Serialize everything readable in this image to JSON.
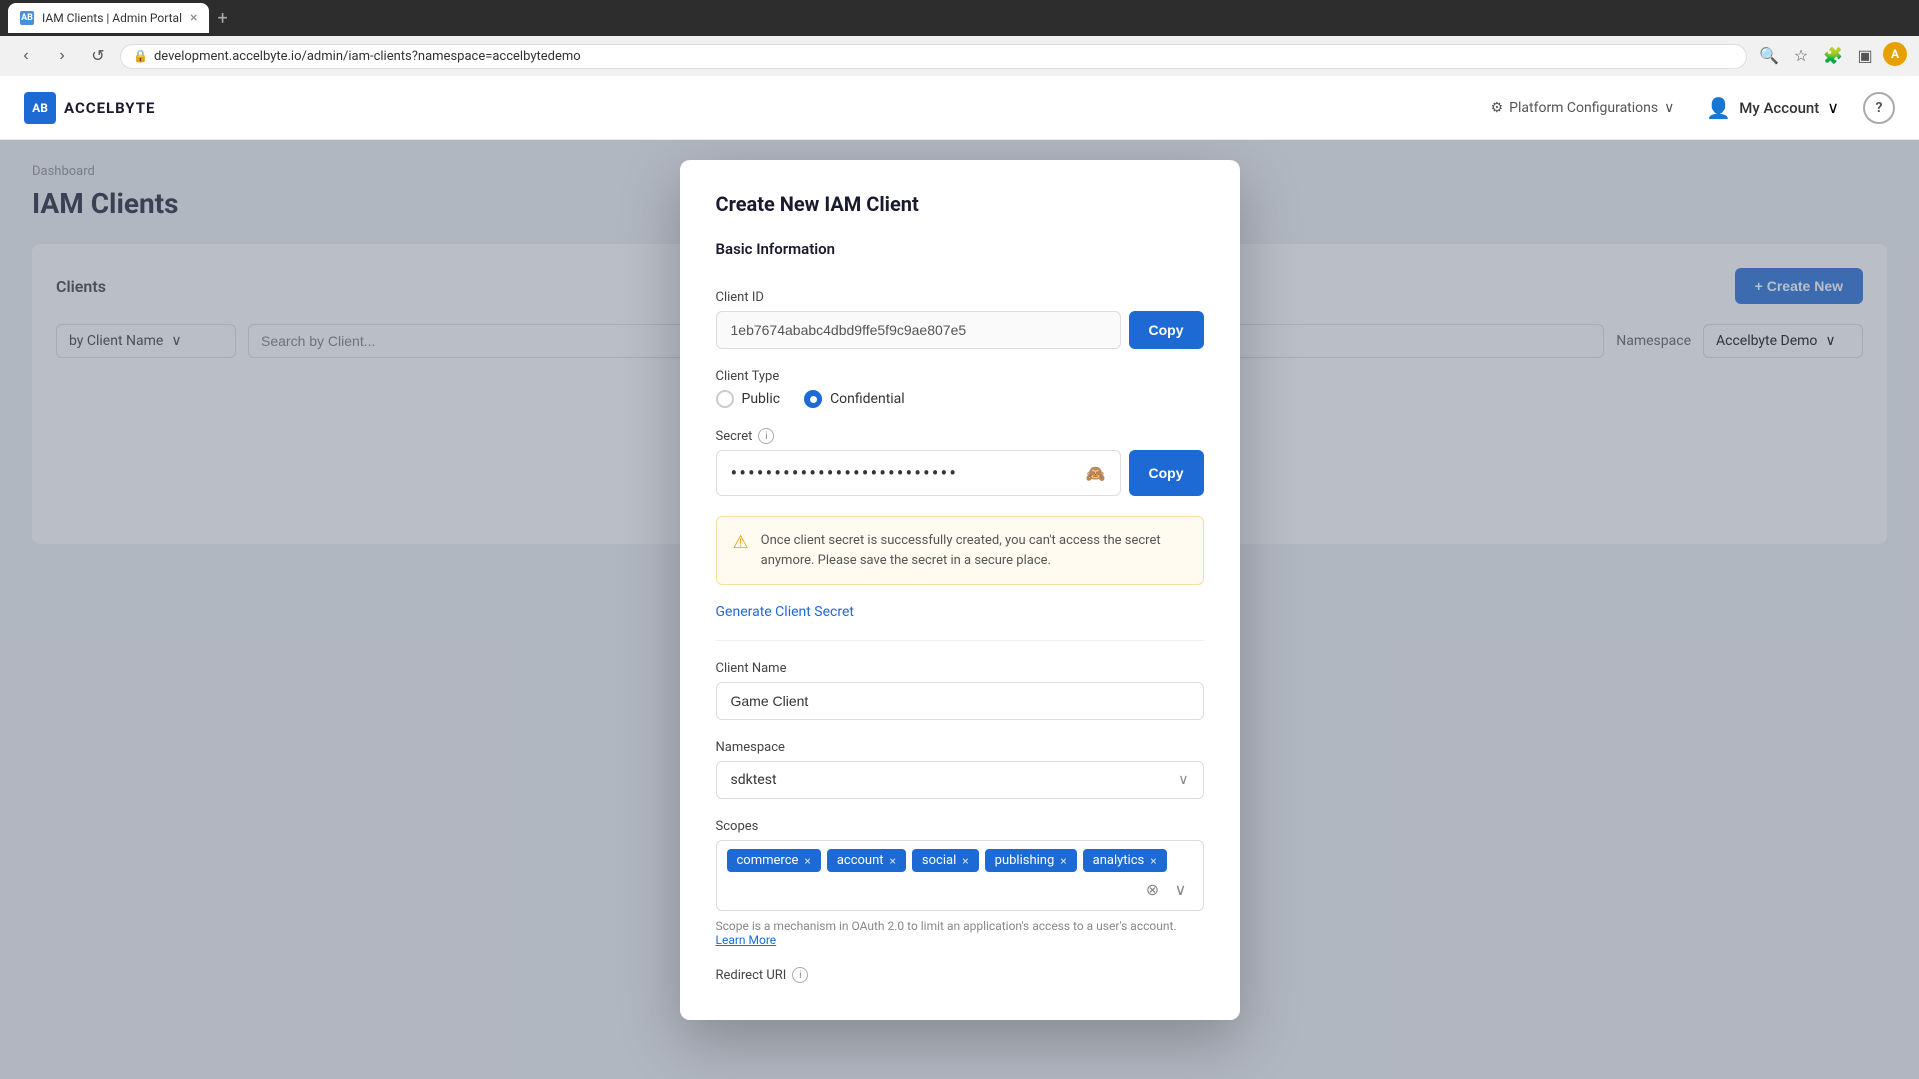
{
  "browser": {
    "tab_title": "IAM Clients | Admin Portal",
    "tab_icon": "AB",
    "close_icon": "×",
    "new_tab_icon": "+",
    "url": "development.accelbyte.io/admin/iam-clients?namespace=accelbytedemo",
    "lock_icon": "🔒",
    "nav_back": "‹",
    "nav_forward": "›",
    "nav_reload": "↺",
    "user_initial": "A"
  },
  "header": {
    "logo_text": "ACCELBYTE",
    "logo_icon": "AB",
    "platform_config_label": "Platform Configurations",
    "my_account_label": "My Account",
    "help_label": "?"
  },
  "page": {
    "breadcrumb": "Dashboard",
    "title": "IAM Clients"
  },
  "clients_panel": {
    "title": "Clients",
    "create_new_label": "+ Create New",
    "filter_label": "by Client Name",
    "search_placeholder": "Search by Client...",
    "namespace_label": "Namespace",
    "namespace_value": "Accelbyte Demo"
  },
  "modal": {
    "title": "Create New IAM Client",
    "section_basic": "Basic Information",
    "client_id_label": "Client ID",
    "client_id_value": "1eb7674ababc4dbd9ffe5f9c9ae807e5",
    "copy_label_1": "Copy",
    "client_type_label": "Client Type",
    "radio_public": "Public",
    "radio_confidential": "Confidential",
    "secret_label": "Secret",
    "secret_value": "••••••••••••••••••••••••••",
    "copy_label_2": "Copy",
    "warning_text": "Once client secret is successfully created, you can't access the secret anymore. Please save the secret in a secure place.",
    "generate_link": "Generate Client Secret",
    "client_name_label": "Client Name",
    "client_name_value": "Game Client",
    "namespace_field_label": "Namespace",
    "namespace_field_value": "sdktest",
    "scopes_label": "Scopes",
    "scopes": [
      {
        "label": "commerce",
        "key": "commerce"
      },
      {
        "label": "account",
        "key": "account"
      },
      {
        "label": "social",
        "key": "social"
      },
      {
        "label": "publishing",
        "key": "publishing"
      },
      {
        "label": "analytics",
        "key": "analytics"
      }
    ],
    "scope_hint": "Scope is a mechanism in OAuth 2.0 to limit an application's access to a user's account.",
    "scope_hint_link": "Learn More",
    "redirect_uri_label": "Redirect URI",
    "eye_icon": "👁",
    "warning_icon": "⚠"
  }
}
